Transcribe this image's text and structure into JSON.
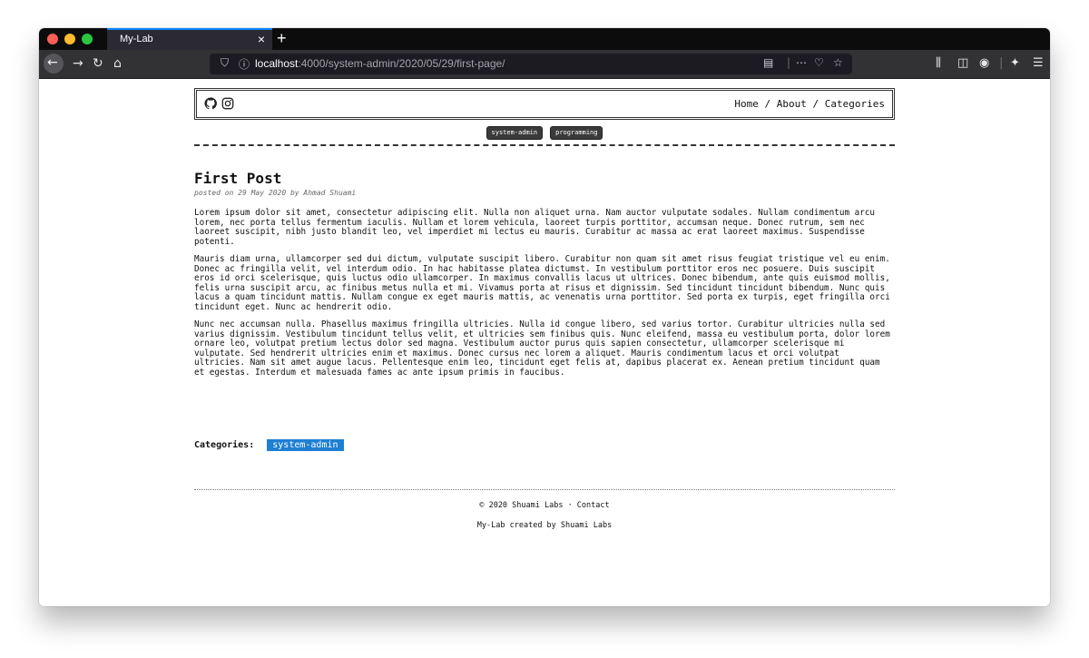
{
  "browser": {
    "tab_title": "My-Lab",
    "tab_close": "×",
    "new_tab": "+",
    "url_host": "localhost",
    "url_rest": ":4000/system-admin/2020/05/29/first-page/",
    "icons": [
      "back-icon",
      "forward-icon",
      "reload-icon",
      "home-icon",
      "shield-icon",
      "info-icon",
      "reader-icon",
      "more-icon",
      "pocket-icon",
      "bookmark-star-icon",
      "library-icon",
      "sidebar-icon",
      "account-icon",
      "extension-icon",
      "menu-icon"
    ]
  },
  "site": {
    "nav": {
      "home": "Home",
      "sep1": " / ",
      "about": "About",
      "sep2": " / ",
      "categories": "Categories"
    },
    "tags": [
      "system-admin",
      "programming"
    ]
  },
  "post": {
    "title": "First Post",
    "meta": "posted on 29 May 2020 by Ahmad Shuami",
    "paragraphs": [
      "Lorem ipsum dolor sit amet, consectetur adipiscing elit. Nulla non aliquet urna. Nam auctor vulputate sodales. Nullam condimentum arcu lorem, nec porta tellus fermentum iaculis. Nullam et lorem vehicula, laoreet turpis porttitor, accumsan neque. Donec rutrum, sem nec laoreet suscipit, nibh justo blandit leo, vel imperdiet mi lectus eu mauris. Curabitur ac massa ac erat laoreet maximus. Suspendisse potenti.",
      "Mauris diam urna, ullamcorper sed dui dictum, vulputate suscipit libero. Curabitur non quam sit amet risus feugiat tristique vel eu enim. Donec ac fringilla velit, vel interdum odio. In hac habitasse platea dictumst. In vestibulum porttitor eros nec posuere. Duis suscipit eros id orci scelerisque, quis luctus odio ullamcorper. In maximus convallis lacus ut ultrices. Donec bibendum, ante quis euismod mollis, felis urna suscipit arcu, ac finibus metus nulla et mi. Vivamus porta at risus et dignissim. Sed tincidunt tincidunt bibendum. Nunc quis lacus a quam tincidunt mattis. Nullam congue ex eget mauris mattis, ac venenatis urna porttitor. Sed porta ex turpis, eget fringilla orci tincidunt eget. Nunc ac hendrerit odio.",
      "Nunc nec accumsan nulla. Phasellus maximus fringilla ultricies. Nulla id congue libero, sed varius tortor. Curabitur ultricies nulla sed varius dignissim. Vestibulum tincidunt tellus velit, et ultricies sem finibus quis. Nunc eleifend, massa eu vestibulum porta, dolor lorem ornare leo, volutpat pretium lectus dolor sed magna. Vestibulum auctor purus quis sapien consectetur, ullamcorper scelerisque mi vulputate. Sed hendrerit ultricies enim et maximus. Donec cursus nec lorem a aliquet. Mauris condimentum lacus et orci volutpat ultricies. Nam sit amet augue lacus. Pellentesque enim leo, tincidunt eget felis at, dapibus placerat ex. Aenean pretium tincidunt quam et egestas. Interdum et malesuada fames ac ante ipsum primis in faucibus."
    ],
    "categories_label": "Categories:",
    "category": "system-admin"
  },
  "footer": {
    "copyright": "© 2020 Shuami Labs · Contact",
    "credit": "My-Lab created by Shuami Labs"
  },
  "colors": {
    "accent": "#1e7fd3",
    "tab_highlight": "#0a84ff",
    "toolbar": "#323234"
  }
}
